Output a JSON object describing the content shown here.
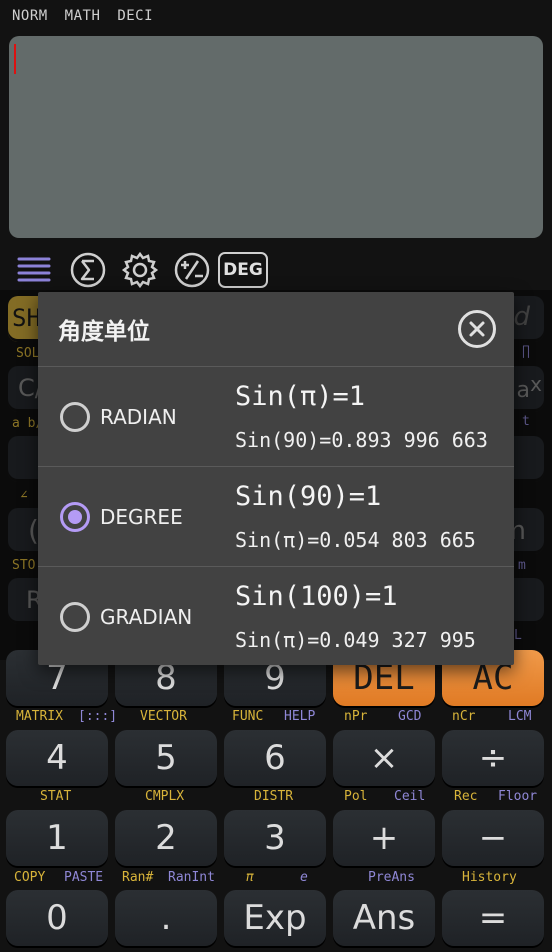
{
  "status_modes": [
    "NORM",
    "MATH",
    "DECI"
  ],
  "tools": {
    "deg_label": "DEG"
  },
  "background_keys": {
    "shift_partial": "SH",
    "sol_partial": "SOL",
    "row2_left": "C/",
    "row2_right": "a",
    "row2_x": "x",
    "ab_partial": "a b/c",
    "t_partial": "t",
    "angle_partial": "∠",
    "paren_partial": "(",
    "m_partial": "m",
    "sto_partial": "STO",
    "r_partial": "R",
    "m2_partial": "m",
    "l_partial": "L",
    "d_partial": "d",
    "pi_partial": "∏"
  },
  "dialog": {
    "title": "角度单位",
    "options": [
      {
        "label": "RADIAN",
        "main": "Sin(π)=1",
        "sub": "Sin(90)=0.893 996 663",
        "selected": false
      },
      {
        "label": "DEGREE",
        "main": "Sin(90)=1",
        "sub": "Sin(π)=0.054 803 665",
        "selected": true
      },
      {
        "label": "GRADIAN",
        "main": "Sin(100)=1",
        "sub": "Sin(π)=0.049 327 995",
        "selected": false
      }
    ]
  },
  "keypad": {
    "row1": {
      "k7": "7",
      "k8": "8",
      "k9": "9",
      "del": "DEL",
      "ac": "AC"
    },
    "row1_sub": {
      "matrix": "MATRIX",
      "matrix_icon": "[:::]",
      "vector": "VECTOR",
      "func": "FUNC",
      "help": "HELP",
      "npr": "nPr",
      "gcd": "GCD",
      "ncr": "nCr",
      "lcm": "LCM"
    },
    "row2": {
      "k4": "4",
      "k5": "5",
      "k6": "6",
      "mul": "×",
      "div": "÷"
    },
    "row2_sub": {
      "stat": "STAT",
      "cmplx": "CMPLX",
      "distr": "DISTR",
      "pol": "Pol",
      "ceil": "Ceil",
      "rec": "Rec",
      "floor": "Floor"
    },
    "row3": {
      "k1": "1",
      "k2": "2",
      "k3": "3",
      "plus": "+",
      "minus": "−"
    },
    "row3_sub": {
      "copy": "COPY",
      "paste": "PASTE",
      "ran": "Ran#",
      "ranint": "RanInt",
      "pi": "π",
      "e": "e",
      "preans": "PreAns",
      "history": "History"
    },
    "row4": {
      "k0": "0",
      "dot": ".",
      "exp": "Exp",
      "ans": "Ans",
      "eq": "="
    }
  },
  "colors": {
    "display": "#636b6a",
    "accent_orange": "#e8832e",
    "radio_selected": "#b49bf5",
    "shift_yellow": "#d8b43a",
    "alpha_purple": "#8f87d6"
  }
}
